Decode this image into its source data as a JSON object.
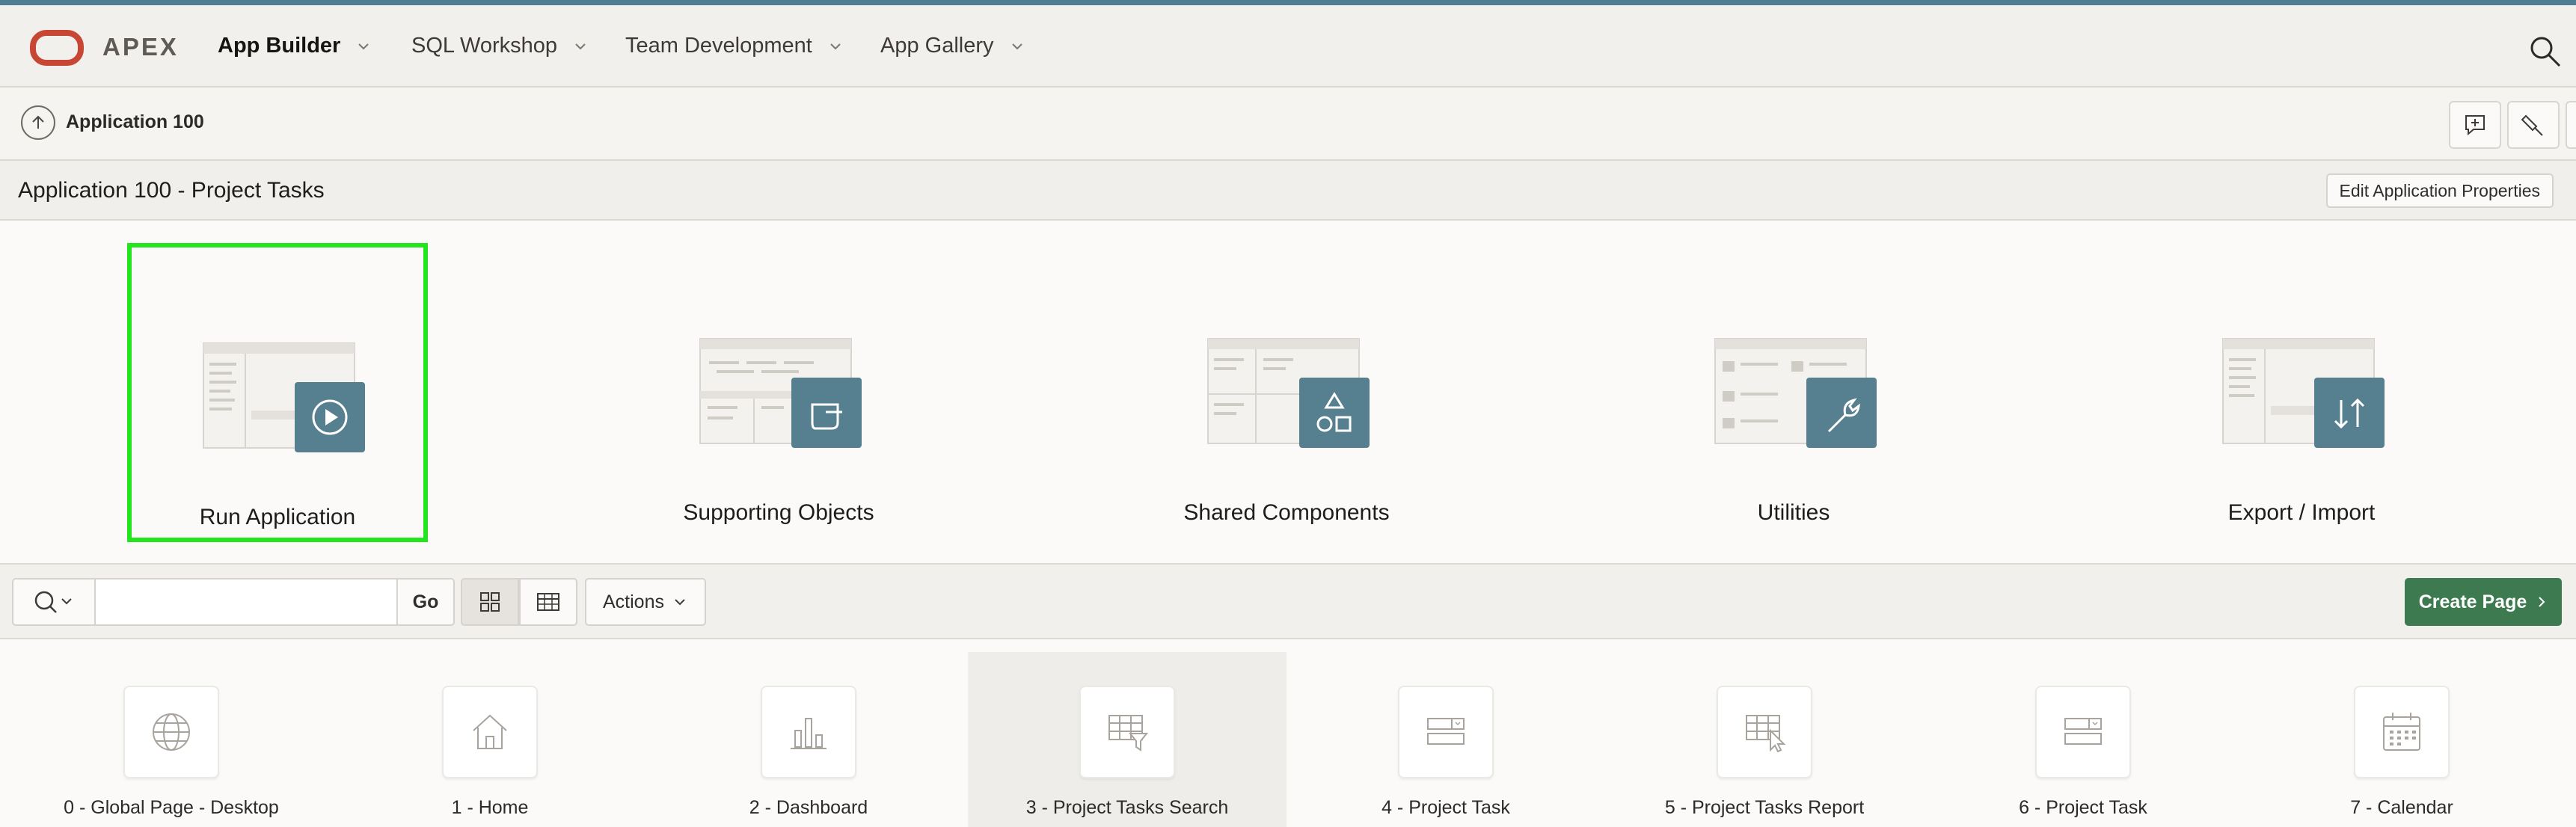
{
  "brand": {
    "name": "APEX",
    "logo_color": "#c74634"
  },
  "topnav": {
    "items": [
      {
        "label": "App Builder",
        "active": true
      },
      {
        "label": "SQL Workshop",
        "active": false
      },
      {
        "label": "Team Development",
        "active": false
      },
      {
        "label": "App Gallery",
        "active": false
      }
    ]
  },
  "breadcrumb": {
    "title": "Application 100"
  },
  "titlebar": {
    "title": "Application 100 - Project Tasks",
    "edit_label": "Edit Application Properties"
  },
  "hero": {
    "cards": [
      {
        "label": "Run Application",
        "icon": "play-icon",
        "selected": true
      },
      {
        "label": "Supporting Objects",
        "icon": "scroll-icon",
        "selected": false
      },
      {
        "label": "Shared Components",
        "icon": "shapes-icon",
        "selected": false
      },
      {
        "label": "Utilities",
        "icon": "wrench-icon",
        "selected": false
      },
      {
        "label": "Export / Import",
        "icon": "transfer-icon",
        "selected": false
      }
    ]
  },
  "toolbar": {
    "search_value": "",
    "go_label": "Go",
    "actions_label": "Actions",
    "create_label": "Create Page"
  },
  "pages": [
    {
      "label": "0 - Global Page - Desktop",
      "icon": "globe-icon"
    },
    {
      "label": "1 - Home",
      "icon": "home-icon"
    },
    {
      "label": "2 - Dashboard",
      "icon": "bar-chart-icon"
    },
    {
      "label": "3 - Project Tasks Search",
      "icon": "table-filter-icon"
    },
    {
      "label": "4 - Project Task",
      "icon": "form-icon"
    },
    {
      "label": "5 - Project Tasks Report",
      "icon": "table-cursor-icon"
    },
    {
      "label": "6 - Project Task",
      "icon": "form-icon"
    },
    {
      "label": "7 - Calendar",
      "icon": "calendar-icon"
    }
  ],
  "colors": {
    "accent": "#4f7d92",
    "tile": "#56808f",
    "create": "#3d7a4f",
    "selection": "#22e51d"
  }
}
